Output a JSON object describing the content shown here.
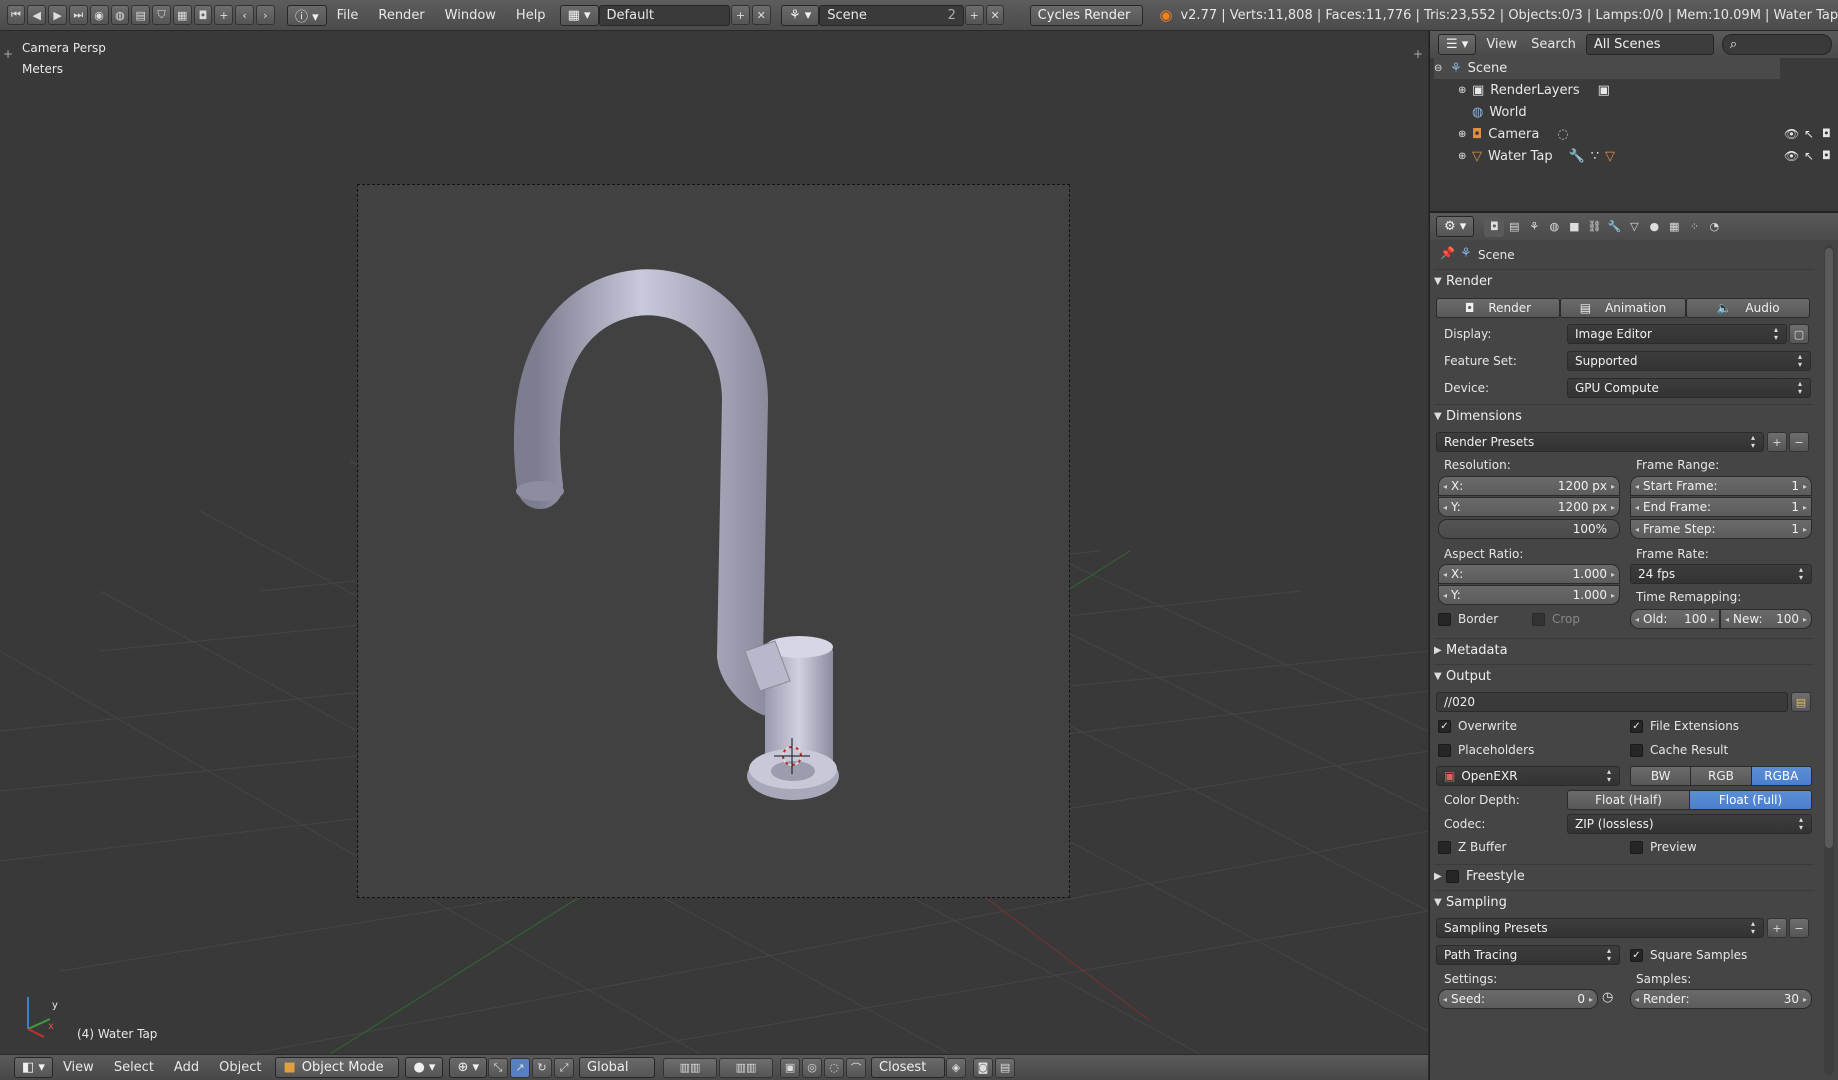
{
  "topbar": {
    "menus": [
      "File",
      "Render",
      "Window",
      "Help"
    ],
    "layout": "Default",
    "scene": "Scene",
    "scene_users": "2",
    "engine": "Cycles Render",
    "status": "v2.77 | Verts:11,808 | Faces:11,776 | Tris:23,552 | Objects:0/3 | Lamps:0/0 | Mem:10.09M | Water Tap"
  },
  "viewport": {
    "view_name": "Camera Persp",
    "units": "Meters",
    "object_label": "(4) Water Tap",
    "axis_x": "x",
    "axis_y": "y"
  },
  "bottombar": {
    "menus": [
      "View",
      "Select",
      "Add",
      "Object"
    ],
    "mode": "Object Mode",
    "orientation": "Global",
    "snap": "Closest"
  },
  "outliner": {
    "view": "View",
    "search": "Search",
    "scene_filter": "All Scenes",
    "items": [
      "Scene",
      "RenderLayers",
      "World",
      "Camera",
      "Water Tap"
    ]
  },
  "properties": {
    "context": "Scene",
    "render": {
      "title": "Render",
      "buttons": [
        "Render",
        "Animation",
        "Audio"
      ],
      "display_label": "Display:",
      "display": "Image Editor",
      "feature_label": "Feature Set:",
      "feature": "Supported",
      "device_label": "Device:",
      "device": "GPU Compute"
    },
    "dimensions": {
      "title": "Dimensions",
      "presets": "Render Presets",
      "resolution_label": "Resolution:",
      "res_x_label": "X:",
      "res_x": "1200 px",
      "res_y_label": "Y:",
      "res_y": "1200 px",
      "res_pct": "100%",
      "frame_range_label": "Frame Range:",
      "start_label": "Start Frame:",
      "start": "1",
      "end_label": "End Frame:",
      "end": "1",
      "step_label": "Frame Step:",
      "step": "1",
      "aspect_label": "Aspect Ratio:",
      "asp_x_label": "X:",
      "asp_x": "1.000",
      "asp_y_label": "Y:",
      "asp_y": "1.000",
      "frame_rate_label": "Frame Rate:",
      "frame_rate": "24 fps",
      "time_remap_label": "Time Remapping:",
      "old_label": "Old:",
      "old": "100",
      "new_label": "New:",
      "new": "100",
      "border": "Border",
      "crop": "Crop"
    },
    "metadata": {
      "title": "Metadata"
    },
    "output": {
      "title": "Output",
      "path": "//020",
      "overwrite": "Overwrite",
      "file_extensions": "File Extensions",
      "placeholders": "Placeholders",
      "cache_result": "Cache Result",
      "format": "OpenEXR",
      "channels": [
        "BW",
        "RGB",
        "RGBA"
      ],
      "color_depth_label": "Color Depth:",
      "depths": [
        "Float (Half)",
        "Float (Full)"
      ],
      "codec_label": "Codec:",
      "codec": "ZIP (lossless)",
      "zbuffer": "Z Buffer",
      "preview": "Preview"
    },
    "freestyle": {
      "title": "Freestyle"
    },
    "sampling": {
      "title": "Sampling",
      "presets": "Sampling Presets",
      "method": "Path Tracing",
      "square_samples": "Square Samples",
      "settings_label": "Settings:",
      "samples_label": "Samples:",
      "seed_label": "Seed:",
      "seed": "0",
      "render_label": "Render:",
      "render": "30"
    }
  },
  "colors": {
    "accent": "#5680c2",
    "header": "#4e4e4e",
    "viewport": "#393939"
  }
}
